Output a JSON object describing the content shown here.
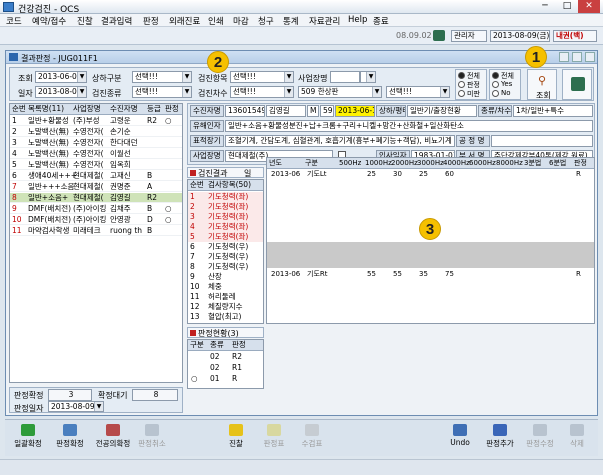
{
  "window": {
    "title": "건강검진 - OCS",
    "minimize": "─",
    "maximize": "□",
    "close": "✕"
  },
  "menu": [
    "코드",
    "예약/접수",
    "진찰",
    "결과입력",
    "판정",
    "외래진료",
    "인쇄",
    "마감",
    "청구",
    "통계",
    "자료관리",
    "Help",
    "종료"
  ],
  "topstrip": {
    "version": "08.09.02",
    "user": "관리자",
    "date": "2013-08-09(금)",
    "extra": "내권(백)"
  },
  "subwindow": {
    "title": "결과판정 - JUG011F1"
  },
  "search": {
    "lbl_query": "조회",
    "query_date": "2013-06-09",
    "lbl_updown": "상하구분",
    "sel1": "선택!!!",
    "lbl_check_item": "검진항목",
    "sel2": "선택!!!",
    "lbl_company": "사업장명",
    "sel3": "",
    "lbl_date": "일자",
    "date_val": "2013-08-09",
    "lbl_check_type": "검진종류",
    "sel4": "선택!!!",
    "lbl_check_count": "검진차수",
    "sel5": "선택!!!",
    "code_val": "509 한상판",
    "sel6": "선택!!!",
    "radio1": [
      "전체",
      "판정",
      "미판"
    ],
    "radio2": [
      "전체",
      "Yes",
      "No"
    ],
    "btn_search": "조회",
    "btn_exit": "종료"
  },
  "left_grid": {
    "headers": [
      "순번",
      "목록명(11)",
      "사업장명",
      "수진자명",
      "등급",
      "판정"
    ],
    "rows": [
      [
        "1",
        "일반+황물성",
        "(주)부성",
        "고령운",
        "R2",
        "○"
      ],
      [
        "2",
        "노말백산(無)",
        "수영전자(",
        "손기순",
        "",
        ""
      ],
      [
        "3",
        "노말백산(無)",
        "수영전자(",
        "한다대던",
        "",
        ""
      ],
      [
        "4",
        "노말백산(無)",
        "수영전자(",
        "이월선",
        "",
        ""
      ],
      [
        "5",
        "노말백산(無)",
        "수영전자(",
        "임옥희",
        "",
        ""
      ],
      [
        "6",
        "생애40세+++",
        "현대제철(",
        "고재신",
        "B",
        ""
      ],
      [
        "7",
        "일반+++소음",
        "현대제철(",
        "권명준",
        "A",
        ""
      ],
      [
        "8",
        "일반+소음+",
        "현대제철(",
        "김영길",
        "R2",
        ""
      ],
      [
        "9",
        "DMF(배치전)",
        "(주)아이킹",
        "김채주",
        "B",
        "○"
      ],
      [
        "10",
        "DMF(배치전)",
        "(주)아이킹",
        "안영광",
        "D",
        "○"
      ],
      [
        "11",
        "마약검사학생",
        "미래테크",
        "ruong th",
        "B",
        ""
      ]
    ]
  },
  "left_summary": {
    "lbl_checked": "판정확정",
    "checked_val": "3",
    "lbl_wait": "확정대기",
    "wait_val": "8",
    "lbl_pdate": "판정일자",
    "pdate_val": "2013-08-09"
  },
  "patient": {
    "lbl_name": "수진자명",
    "pid": "13601549",
    "name": "김영길",
    "sex": "M",
    "age": "59",
    "exam_date": "2013-06-18",
    "kind_label": "상하/평태",
    "kind_val": "일반기/출장현황",
    "lbl_type": "종류/차수",
    "type_val": "1차/일반+특수",
    "lbl_harm": "유해인자",
    "harm_val": "일반+소음+황물성분진+납+크롬+구리+니켈+망간+산화철+일산화탄소",
    "lbl_work": "표적장기",
    "work_val": "조혈기계, 간담도계, 심혈관계, 호흡기계(흉부+폐기능+객담), 비뇨기계",
    "lbl_proc": "공 정 명",
    "lbl_company": "사업장명",
    "company_val": "현대제철(주)",
    "lbl_enter": "입사일자",
    "enter_val": "1983-01-01",
    "lbl_dept": "부 서 명",
    "dept_val": "주단강제강부40톤(제강,원료)"
  },
  "result_tabs": {
    "tab1": "검진결과",
    "tab2": "일"
  },
  "test_list": {
    "header": [
      "순번",
      "검사항목(50)"
    ],
    "rows": [
      [
        "1",
        "기도청력(좌)"
      ],
      [
        "2",
        "기도청력(좌)"
      ],
      [
        "3",
        "기도청력(좌)"
      ],
      [
        "4",
        "기도청력(좌)"
      ],
      [
        "5",
        "기도청력(좌)"
      ],
      [
        "6",
        "기도청력(우)"
      ],
      [
        "7",
        "기도청력(우)"
      ],
      [
        "8",
        "기도청력(우)"
      ],
      [
        "9",
        "산장"
      ],
      [
        "10",
        "체중"
      ],
      [
        "11",
        "허리둘레"
      ],
      [
        "12",
        "체질량지수"
      ],
      [
        "13",
        "혈압(최고)"
      ]
    ]
  },
  "hearing": {
    "headers": [
      "년도",
      "구분",
      "500Hz",
      "1000Hz",
      "2000Hz",
      "3000Hz",
      "4000Hz",
      "6000Hz",
      "8000Hz",
      "3분법",
      "6분법",
      "판정"
    ],
    "rows": [
      [
        "2013-06",
        "기도Lt",
        "",
        "25",
        "30",
        "25",
        "60",
        "",
        "",
        "",
        "",
        "R"
      ],
      [
        "2013-06",
        "기도Rt",
        "",
        "55",
        "55",
        "35",
        "75",
        "",
        "",
        "",
        "",
        "R"
      ]
    ]
  },
  "judge": {
    "tab": "판정현황(3)",
    "headers": [
      "구분",
      "종류",
      "판정"
    ],
    "rows": [
      [
        "",
        "02",
        "R2"
      ],
      [
        "",
        "02",
        "R1"
      ],
      [
        "○",
        "01",
        "R"
      ]
    ]
  },
  "buttons": {
    "all_check": "일괄확정",
    "judge_confirm": "판정확정",
    "expert_confirm": "전공의확정",
    "confirm_cancel": "판정취소",
    "exam": "진찰",
    "judge_sheet": "판정표",
    "print": "수검표",
    "undo": "Undo",
    "add_judge": "판정추가",
    "save": "판정수정",
    "delete": "삭제"
  },
  "callouts": [
    "1",
    "2",
    "3"
  ]
}
